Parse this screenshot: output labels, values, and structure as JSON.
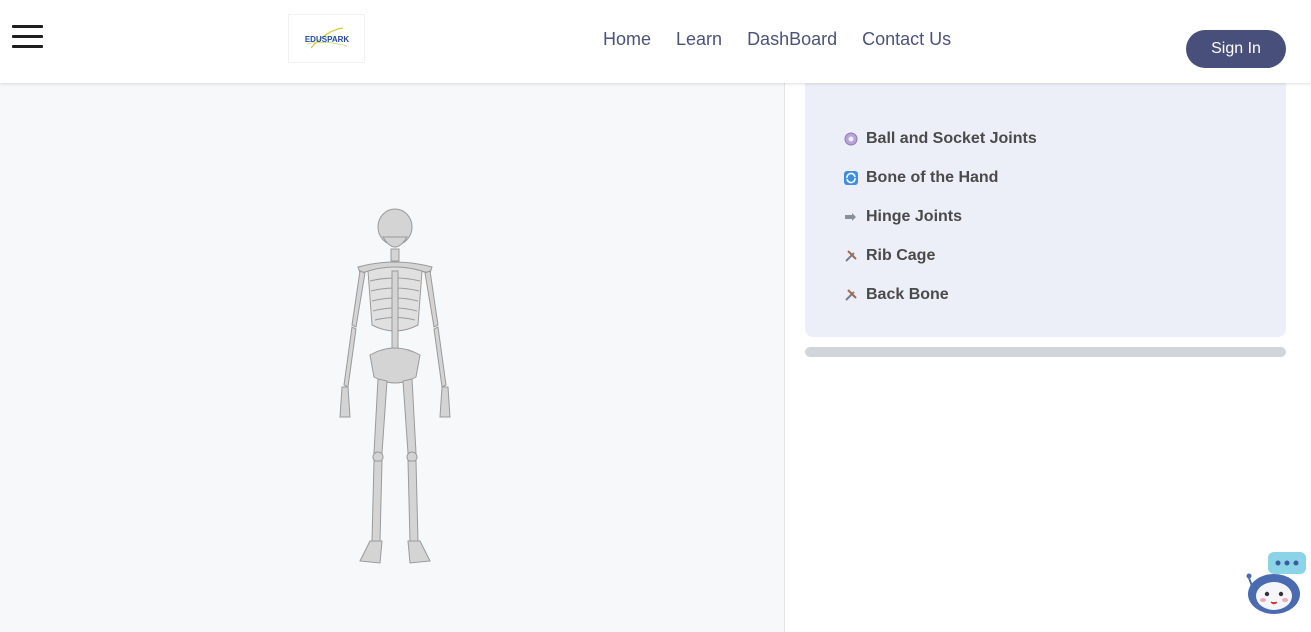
{
  "header": {
    "logo_text": "EDUSPARK",
    "nav": [
      {
        "label": "Home"
      },
      {
        "label": "Learn"
      },
      {
        "label": "DashBoard"
      },
      {
        "label": "Contact Us"
      }
    ],
    "signin_label": "Sign In"
  },
  "panel": {
    "topics": [
      {
        "icon": "gear-icon",
        "label": "Ball and Socket Joints"
      },
      {
        "icon": "cycle-icon",
        "label": "Bone of the Hand"
      },
      {
        "icon": "bolt-icon",
        "label": "Hinge Joints"
      },
      {
        "icon": "tools-icon",
        "label": "Rib Cage"
      },
      {
        "icon": "tools-icon",
        "label": "Back Bone"
      }
    ]
  },
  "colors": {
    "brand": "#474f7a",
    "nav_text": "#4b5378",
    "panel_bg": "#eceff7",
    "viewer_bg": "#f7f8fa"
  }
}
